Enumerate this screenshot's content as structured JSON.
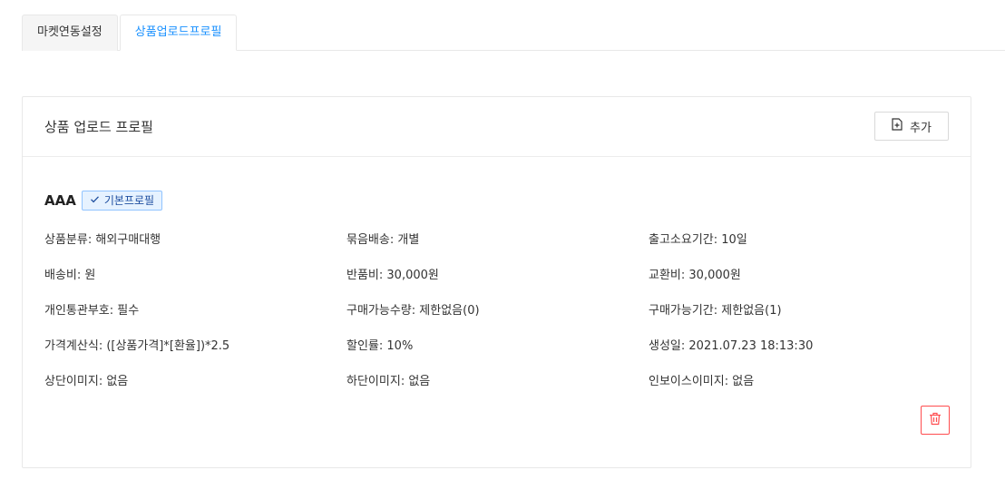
{
  "tabs": [
    {
      "label": "마켓연동설정",
      "active": false
    },
    {
      "label": "상품업로드프로필",
      "active": true
    }
  ],
  "card": {
    "title": "상품 업로드 프로필",
    "add_label": "추가"
  },
  "profile": {
    "name": "AAA",
    "badge": "기본프로필",
    "fields": [
      {
        "label": "상품분류",
        "value": "해외구매대행"
      },
      {
        "label": "묶음배송",
        "value": "개별"
      },
      {
        "label": "출고소요기간",
        "value": "10일"
      },
      {
        "label": "배송비",
        "value": "원"
      },
      {
        "label": "반품비",
        "value": "30,000원"
      },
      {
        "label": "교환비",
        "value": "30,000원"
      },
      {
        "label": "개인통관부호",
        "value": "필수"
      },
      {
        "label": "구매가능수량",
        "value": "제한없음(0)"
      },
      {
        "label": "구매가능기간",
        "value": "제한없음(1)"
      },
      {
        "label": "가격계산식",
        "value": "([상품가격]*[환율])*2.5"
      },
      {
        "label": "할인률",
        "value": "10%"
      },
      {
        "label": "생성일",
        "value": "2021.07.23 18:13:30"
      },
      {
        "label": "상단이미지",
        "value": "없음"
      },
      {
        "label": "하단이미지",
        "value": "없음"
      },
      {
        "label": "인보이스이미지",
        "value": "없음"
      }
    ]
  },
  "icons": {
    "add": "file-add-icon",
    "badge": "check-icon",
    "delete": "trash-icon"
  },
  "colors": {
    "accent": "#1890ff",
    "danger": "#ff4d4f",
    "badge_bg": "#e6f2ff"
  }
}
